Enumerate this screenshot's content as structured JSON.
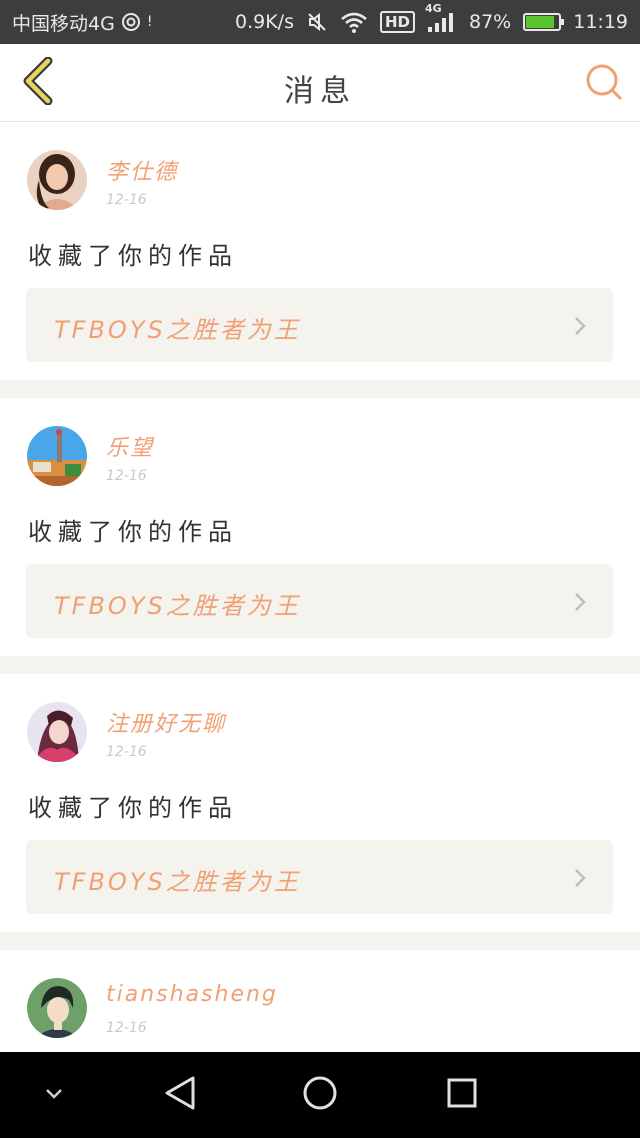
{
  "status_bar": {
    "carrier": "中国移动4G",
    "speed": "0.9K/s",
    "network": "4G",
    "hd_label": "HD",
    "battery": "87%",
    "battery_level": 0.87,
    "time": "11:19",
    "icons": [
      "hotspot-icon",
      "mute-icon",
      "wifi-icon",
      "signal-icon",
      "battery-icon"
    ]
  },
  "nav": {
    "title": "消息",
    "back_icon": "chevron-left-icon",
    "search_icon": "search-icon",
    "accent": "#f0a074"
  },
  "messages": [
    {
      "user": "李仕德",
      "date": "12-16",
      "action": "收藏了你的作品",
      "work": "TFBOYS之胜者为王",
      "avatar": "avatar-woman"
    },
    {
      "user": "乐望",
      "date": "12-16",
      "action": "收藏了你的作品",
      "work": "TFBOYS之胜者为王",
      "avatar": "avatar-park"
    },
    {
      "user": "注册好无聊",
      "date": "12-16",
      "action": "收藏了你的作品",
      "work": "TFBOYS之胜者为王",
      "avatar": "avatar-anime-girl"
    },
    {
      "user": "tianshasheng",
      "date": "12-16",
      "avatar": "avatar-anime-man"
    }
  ],
  "system_bar": {
    "icons": [
      "collapse-icon",
      "back-triangle-icon",
      "home-circle-icon",
      "recents-square-icon"
    ]
  }
}
